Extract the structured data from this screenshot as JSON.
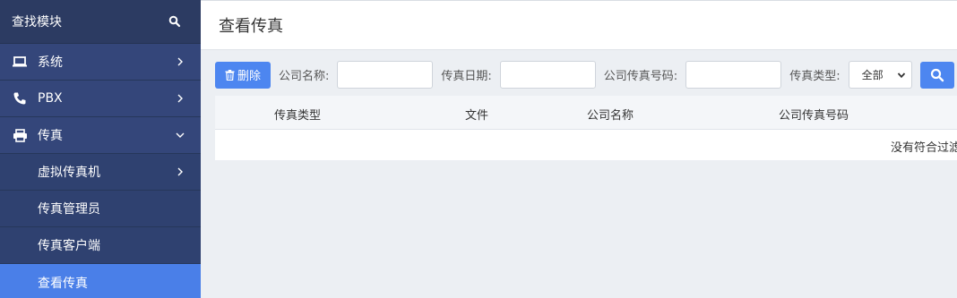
{
  "sidebar": {
    "search_label": "查找模块",
    "items": [
      {
        "label": "系统",
        "icon": "laptop-icon"
      },
      {
        "label": "PBX",
        "icon": "phone-icon"
      },
      {
        "label": "传真",
        "icon": "printer-icon"
      }
    ],
    "sub_items": [
      {
        "label": "虚拟传真机"
      },
      {
        "label": "传真管理员"
      },
      {
        "label": "传真客户端"
      },
      {
        "label": "查看传真"
      }
    ],
    "active_color": "#4a7fe8"
  },
  "main": {
    "title": "查看传真",
    "toolbar": {
      "delete_label": "删除",
      "company_name_label": "公司名称:",
      "fax_date_label": "传真日期:",
      "company_fax_label": "公司传真号码:",
      "fax_type_label": "传真类型:",
      "fax_type_value": "全部"
    },
    "table": {
      "columns": [
        "传真类型",
        "文件",
        "公司名称",
        "公司传真号码"
      ],
      "empty_text": "没有符合过滤"
    }
  }
}
